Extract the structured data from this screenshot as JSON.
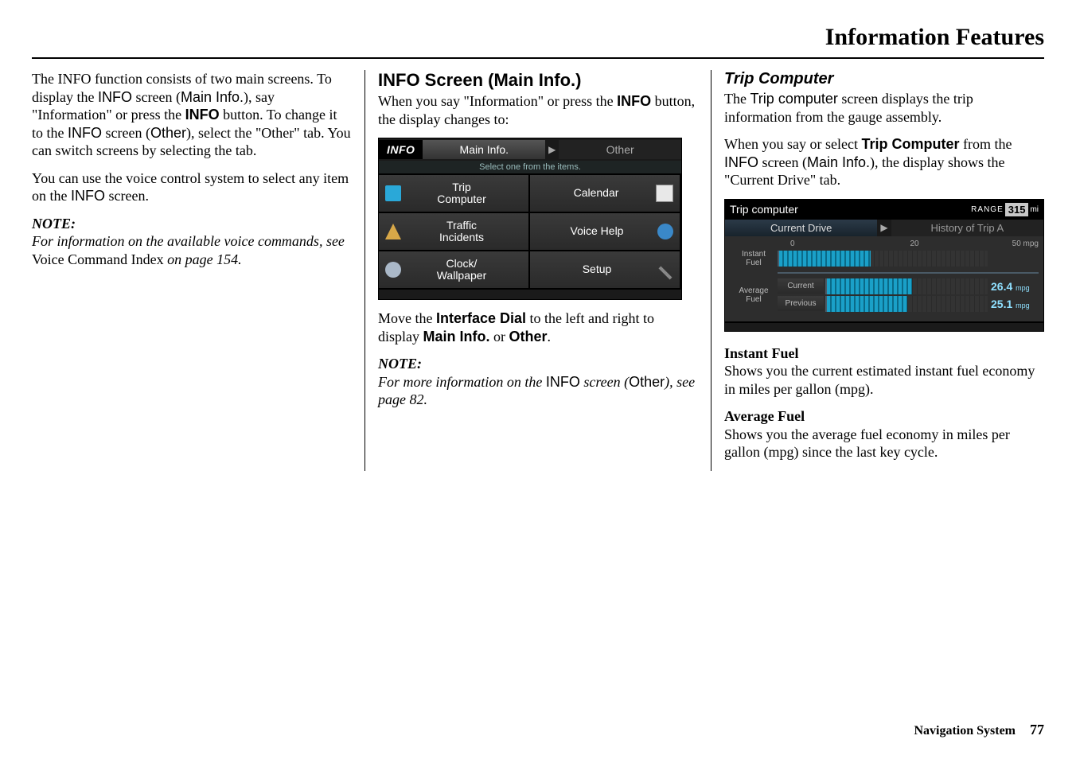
{
  "page_title": "Information Features",
  "footer": {
    "section": "Navigation System",
    "page_num": "77"
  },
  "col1": {
    "p1_a": "The INFO function consists of two main screens. To display the ",
    "p1_b": "INFO",
    "p1_c": " screen (",
    "p1_d": "Main Info.",
    "p1_e": "), say \"Information\" or press the ",
    "p1_f": "INFO",
    "p1_g": " button. To change it to the ",
    "p1_h": "INFO",
    "p1_i": " screen (",
    "p1_j": "Other",
    "p1_k": "), select the \"Other\" tab. You can switch screens by selecting the tab.",
    "p2_a": "You can use the voice control system to select any item on the ",
    "p2_b": "INFO",
    "p2_c": " screen.",
    "note_label": "NOTE:",
    "note_a": "For information on the available voice commands, see ",
    "note_b": "Voice Command Index",
    "note_c": " on page 154."
  },
  "col2": {
    "h1": "INFO Screen (Main Info.)",
    "p1_a": "When you say \"Information\" or press the ",
    "p1_b": "INFO",
    "p1_c": " button, the display changes to:",
    "info_screen": {
      "label": "INFO",
      "tab_active": "Main Info.",
      "tab_inactive": "Other",
      "subtitle": "Select one from the items.",
      "cells": [
        {
          "name": "trip-computer-item",
          "text": "Trip\nComputer",
          "icon": "fuel-icon",
          "color": "#2aa8d8"
        },
        {
          "name": "calendar-item",
          "text": "Calendar",
          "icon": "calendar-icon",
          "color": "#d8a848"
        },
        {
          "name": "traffic-incidents-item",
          "text": "Traffic\nIncidents",
          "icon": "warning-icon",
          "color": "#d8a848"
        },
        {
          "name": "voice-help-item",
          "text": "Voice Help",
          "icon": "help-icon",
          "color": "#3a88c8"
        },
        {
          "name": "clock-wallpaper-item",
          "text": "Clock/\nWallpaper",
          "icon": "clock-icon",
          "color": "#aab8c8"
        },
        {
          "name": "setup-item",
          "text": "Setup",
          "icon": "wrench-icon",
          "color": "#aab8c8"
        }
      ]
    },
    "p2_a": "Move the ",
    "p2_b": "Interface Dial",
    "p2_c": " to the left and right to display ",
    "p2_d": "Main Info.",
    "p2_e": " or ",
    "p2_f": "Other",
    "p2_g": ".",
    "note_label": "NOTE:",
    "note_a": "For more information on the ",
    "note_b": "INFO",
    "note_c": " screen (",
    "note_d": "Other",
    "note_e": "), see page 82."
  },
  "col3": {
    "h2": "Trip Computer",
    "p1_a": "The ",
    "p1_b": "Trip computer",
    "p1_c": " screen displays the trip information from the gauge assembly.",
    "p2_a": "When you say or select ",
    "p2_b": "Trip Computer",
    "p2_c": " from the ",
    "p2_d": "INFO",
    "p2_e": " screen (",
    "p2_f": "Main Info.",
    "p2_g": "), the display shows the \"Current Drive\" tab.",
    "trip_screen": {
      "title": "Trip computer",
      "range_label": "RANGE",
      "range_value": "315",
      "range_unit": "mi",
      "tab_active": "Current Drive",
      "tab_inactive": "History of Trip A",
      "axis": [
        "0",
        "20",
        "50 mpg"
      ],
      "instant_label": "Instant\nFuel",
      "average_label": "Average\nFuel",
      "current_label": "Current",
      "previous_label": "Previous",
      "current_val": "26.4",
      "previous_val": "25.1",
      "unit": "mpg"
    },
    "s1_h": "Instant Fuel",
    "s1_p": "Shows you the current estimated instant fuel economy in miles per gallon (mpg).",
    "s2_h": "Average Fuel",
    "s2_p": "Shows you the average fuel economy in miles per gallon (mpg) since the last key cycle."
  },
  "chart_data": {
    "type": "bar",
    "title": "Trip computer — Current Drive",
    "xlabel": "mpg",
    "xlim": [
      0,
      50
    ],
    "ticks": [
      0,
      20,
      50
    ],
    "series": [
      {
        "name": "Instant Fuel",
        "value": 22,
        "note": "estimated from bar length"
      },
      {
        "name": "Average Fuel — Current",
        "value": 26.4
      },
      {
        "name": "Average Fuel — Previous",
        "value": 25.1
      }
    ],
    "range_mi": 315
  }
}
